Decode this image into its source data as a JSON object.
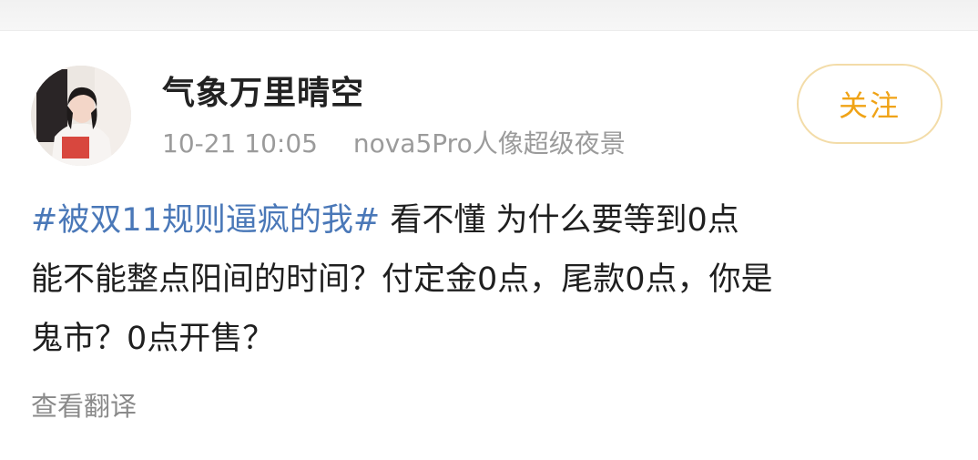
{
  "post": {
    "author": {
      "name": "气象万里晴空",
      "avatar_icon": "user-avatar-photo"
    },
    "timestamp": "10-21 10:05",
    "device": "nova5Pro人像超级夜景",
    "follow_label": "关注",
    "hashtag": "#被双11规则逼疯的我#",
    "text_line1": " 看不懂 为什么要等到0点",
    "text_line2": "能不能整点阳间的时间？付定金0点，尾款0点，你是",
    "text_line3": "鬼市？0点开售？",
    "translate_label": "查看翻译"
  },
  "colors": {
    "hashtag": "#4a78b8",
    "follow_text": "#f0a316",
    "follow_border": "#f3dca8",
    "meta_text": "#9b9b9b"
  }
}
